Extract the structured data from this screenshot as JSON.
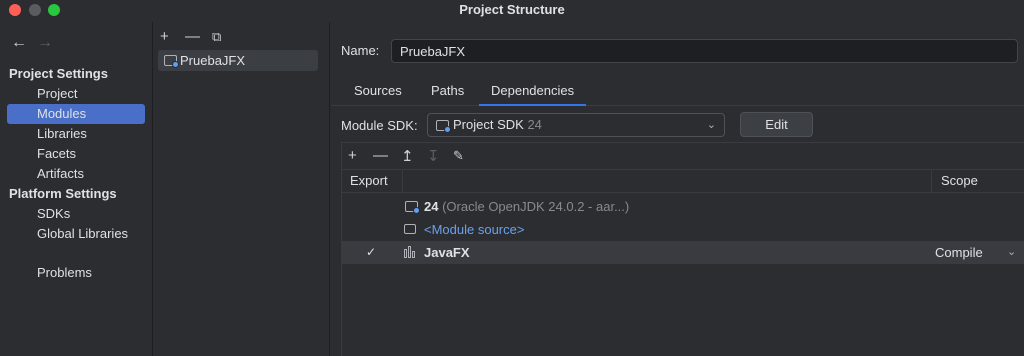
{
  "window": {
    "title": "Project Structure"
  },
  "nav": {
    "back": "←",
    "forward": "→"
  },
  "sidebar": {
    "project_settings_header": "Project Settings",
    "project_settings": [
      "Project",
      "Modules",
      "Libraries",
      "Facets",
      "Artifacts"
    ],
    "platform_settings_header": "Platform Settings",
    "platform_settings": [
      "SDKs",
      "Global Libraries"
    ],
    "other": [
      "Problems"
    ]
  },
  "modules": {
    "toolbar": {
      "add": "+",
      "remove": "—",
      "copy": "⧉"
    },
    "items": [
      "PruebaJFX"
    ]
  },
  "main": {
    "name_label": "Name:",
    "name_value": "PruebaJFX",
    "tabs": [
      "Sources",
      "Paths",
      "Dependencies"
    ],
    "active_tab": "Dependencies",
    "module_sdk_label": "Module SDK:",
    "module_sdk_name": "Project SDK",
    "module_sdk_version": "24",
    "edit_label": "Edit"
  },
  "dependencies": {
    "toolbar": {
      "add": "+",
      "remove": "—",
      "move_up": "↥",
      "move_down": "↧",
      "edit": "✎"
    },
    "columns": {
      "export": "Export",
      "scope": "Scope"
    },
    "rows": [
      {
        "num": "24",
        "desc": "(Oracle OpenJDK 24.0.2 - aar...)"
      },
      {
        "text": "<Module source>"
      },
      {
        "text": "JavaFX",
        "checked": "✓",
        "scope": "Compile"
      }
    ]
  },
  "colors": {
    "accent": "#3574f0",
    "selection": "#4a6fc9",
    "link": "#6ba0ee",
    "background": "#2b2d30"
  }
}
